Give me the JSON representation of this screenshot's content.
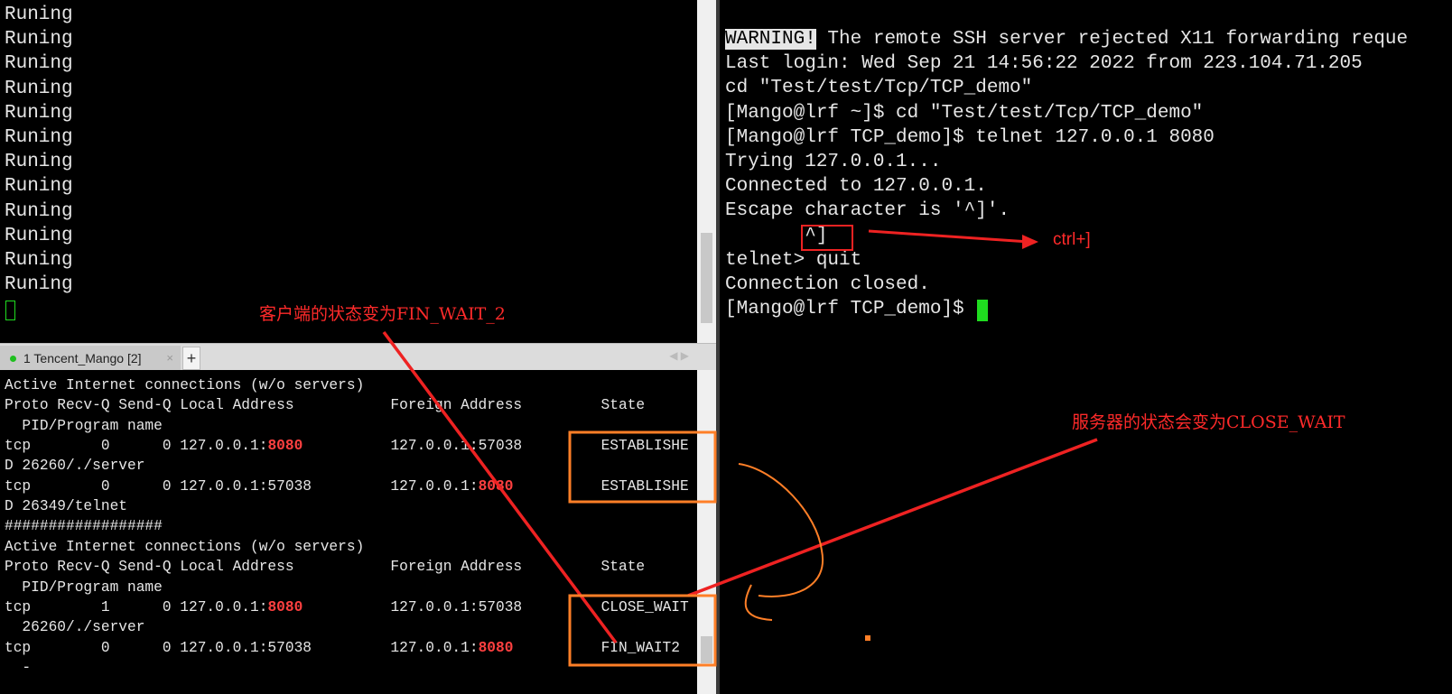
{
  "top_left_terminal": {
    "lines": [
      [
        {
          "t": "Runing"
        }
      ],
      [
        {
          "t": "Runing"
        }
      ],
      [
        {
          "t": "Runing"
        }
      ],
      [
        {
          "t": "Runing"
        }
      ],
      [
        {
          "t": "Runing"
        }
      ],
      [
        {
          "t": "Runing"
        }
      ],
      [
        {
          "t": "Runing"
        }
      ],
      [
        {
          "t": "Runing"
        }
      ],
      [
        {
          "t": "Runing"
        }
      ],
      [
        {
          "t": "Runing"
        }
      ],
      [
        {
          "t": "Runing"
        }
      ],
      [
        {
          "t": "Runing"
        }
      ]
    ]
  },
  "tab_bar": {
    "tab_label": "1 Tencent_Mango [2]",
    "tab_status_color": "#1fbf1f",
    "close_glyph": "×",
    "new_tab_glyph": "+",
    "scroll_arrows": "◀ ▶"
  },
  "bottom_left_terminal": {
    "lines": [
      [
        {
          "t": "Active Internet connections (w/o servers)"
        }
      ],
      [
        {
          "t": "Proto Recv-Q Send-Q Local Address           Foreign Address         State"
        }
      ],
      [
        {
          "t": "  PID/Program name"
        }
      ],
      [
        {
          "t": "tcp        0      0 127.0.0.1:"
        },
        {
          "t": "8080",
          "c": "red"
        },
        {
          "t": "          127.0.0.1:57038         ESTABLISHE"
        }
      ],
      [
        {
          "t": "D 26260/./server"
        }
      ],
      [
        {
          "t": "tcp        0      0 127.0.0.1:57038         127.0.0.1:"
        },
        {
          "t": "8080",
          "c": "red"
        },
        {
          "t": "          ESTABLISHE"
        }
      ],
      [
        {
          "t": "D 26349/telnet"
        }
      ],
      [
        {
          "t": "##################"
        }
      ],
      [
        {
          "t": "Active Internet connections (w/o servers)"
        }
      ],
      [
        {
          "t": "Proto Recv-Q Send-Q Local Address           Foreign Address         State"
        }
      ],
      [
        {
          "t": "  PID/Program name"
        }
      ],
      [
        {
          "t": "tcp        1      0 127.0.0.1:"
        },
        {
          "t": "8080",
          "c": "red"
        },
        {
          "t": "          127.0.0.1:57038         CLOSE_WAIT"
        }
      ],
      [
        {
          "t": "  26260/./server"
        }
      ],
      [
        {
          "t": "tcp        0      0 127.0.0.1:57038         127.0.0.1:"
        },
        {
          "t": "8080",
          "c": "red"
        },
        {
          "t": "          FIN_WAIT2"
        }
      ],
      [
        {
          "t": "  -"
        }
      ]
    ]
  },
  "right_terminal": {
    "lines": [
      [
        {
          "t": "WARNING!",
          "c": "inv"
        },
        {
          "t": " The remote SSH server rejected X11 forwarding reque"
        }
      ],
      [
        {
          "t": "Last login: Wed Sep 21 14:56:22 2022 from 223.104.71.205"
        }
      ],
      [
        {
          "t": "cd \"Test/test/Tcp/TCP_demo\""
        }
      ],
      [
        {
          "t": "[Mango@lrf ~]$ cd \"Test/test/Tcp/TCP_demo\""
        }
      ],
      [
        {
          "t": "[Mango@lrf TCP_demo]$ telnet 127.0.0.1 8080"
        }
      ],
      [
        {
          "t": "Trying 127.0.0.1..."
        }
      ],
      [
        {
          "t": "Connected to 127.0.0.1."
        }
      ],
      [
        {
          "t": "Escape character is '^]'."
        }
      ],
      [
        {
          "t": "       ^]"
        }
      ],
      [
        {
          "t": "telnet> quit"
        }
      ],
      [
        {
          "t": "Connection closed."
        }
      ],
      [
        {
          "t": "[Mango@lrf TCP_demo]$ "
        }
      ]
    ]
  },
  "annotations": {
    "client_state": "客户端的状态变为FIN_WAIT_2",
    "server_state": "服务器的状态会变为CLOSE_WAIT",
    "ctrl_key": "ctrl+]",
    "arrow_color": "#ee2222",
    "box_color": "#ff7f27"
  }
}
